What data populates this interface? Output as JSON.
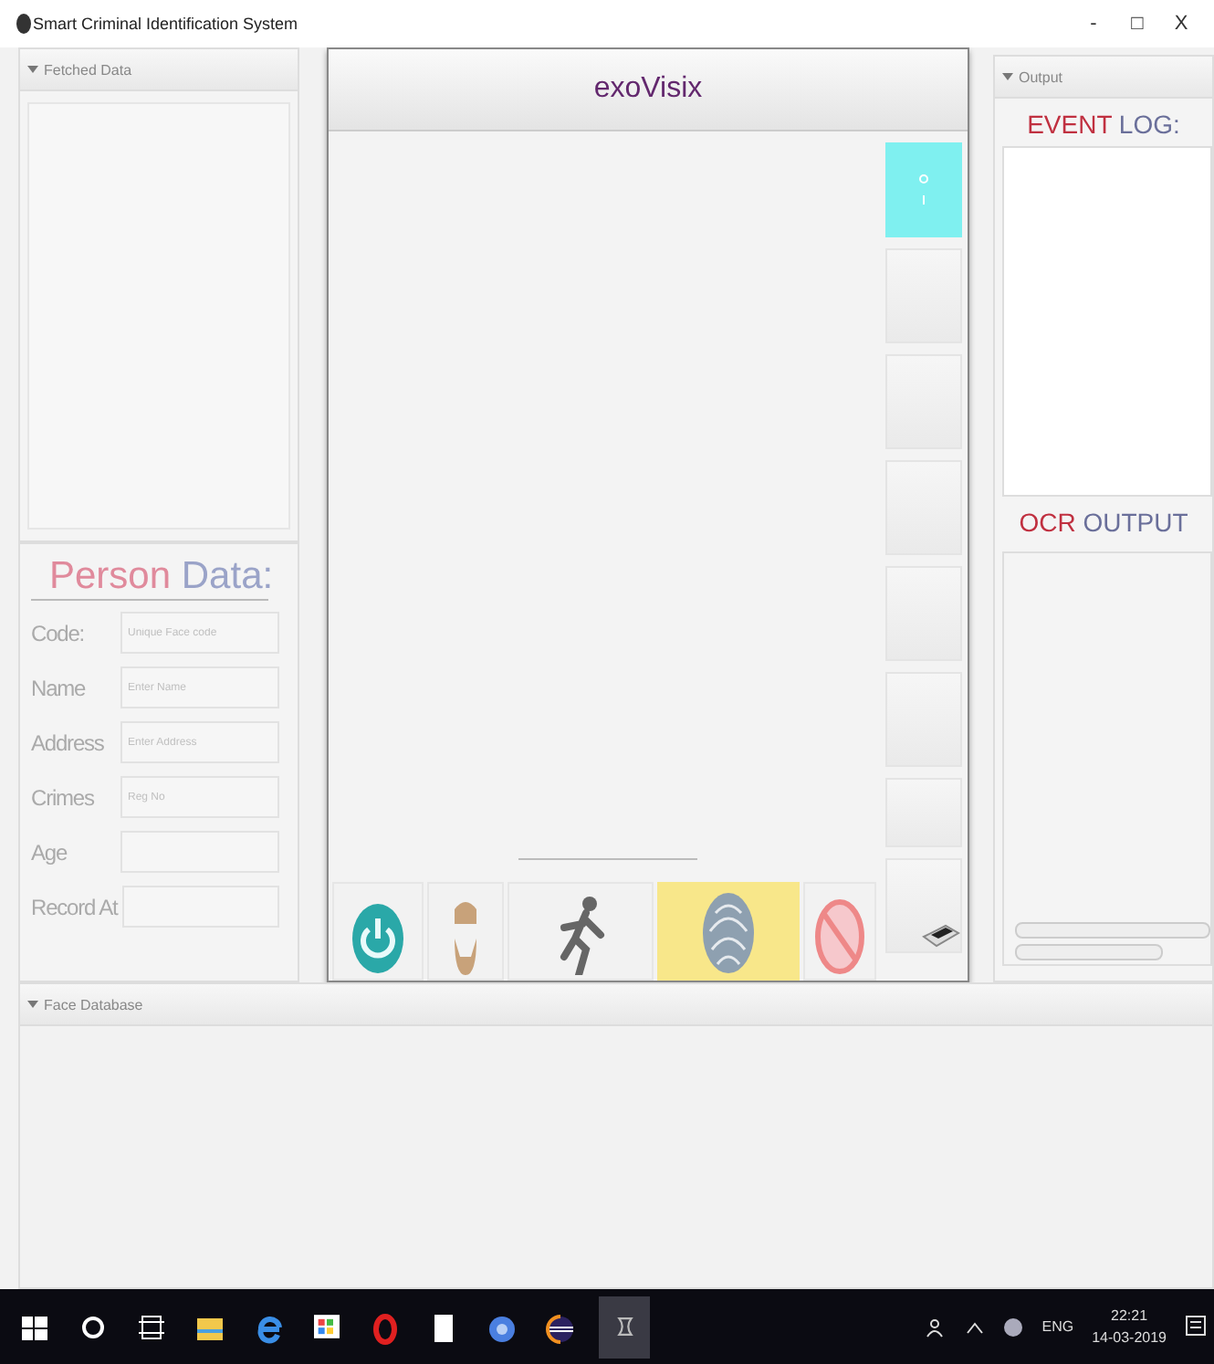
{
  "window": {
    "title": "Smart Criminal Identification System",
    "controls": [
      "-",
      "□",
      "X"
    ]
  },
  "fetched_data": {
    "header": "Fetched Data",
    "expanded": true
  },
  "person_data": {
    "heading": "Person Data:",
    "fields": [
      {
        "label": "Code:",
        "placeholder": "Unique Face code"
      },
      {
        "label": "Name",
        "placeholder": "Enter Name"
      },
      {
        "label": "Address",
        "placeholder": "Enter Address"
      },
      {
        "label": "Crimes",
        "placeholder": "Reg No"
      },
      {
        "label": "Age"
      },
      {
        "label": "Record At"
      }
    ]
  },
  "viewer": {
    "title": "exoVisix"
  },
  "side_buttons": [
    {
      "kind": "toggle",
      "on": true
    },
    {
      "kind": "blank",
      "on": false
    },
    {
      "kind": "blank",
      "on": false
    },
    {
      "kind": "blank",
      "on": false
    },
    {
      "kind": "blank",
      "on": false
    },
    {
      "kind": "blank",
      "on": false
    },
    {
      "kind": "blank",
      "on": false
    },
    {
      "kind": "printer",
      "on": false
    }
  ],
  "tools": [
    {
      "kind": "power",
      "selected": false
    },
    {
      "kind": "face",
      "selected": false
    },
    {
      "kind": "runner",
      "selected": false
    },
    {
      "kind": "fingerprint",
      "selected": true
    },
    {
      "kind": "forbidden",
      "selected": false
    }
  ],
  "output": {
    "header": "Output",
    "expanded": true,
    "event_log": "EVENT LOG:",
    "ocr_output": "OCR OUTPUT"
  },
  "face_database": {
    "header": "Face Database",
    "expanded": true
  },
  "taskbar": {
    "apps": [
      {
        "kind": "start"
      },
      {
        "kind": "search"
      },
      {
        "kind": "taskview"
      },
      {
        "kind": "folder"
      },
      {
        "kind": "edge"
      },
      {
        "kind": "store"
      },
      {
        "kind": "opera"
      },
      {
        "kind": "file"
      },
      {
        "kind": "chrome"
      },
      {
        "kind": "eclipse"
      },
      {
        "kind": "java",
        "active": true
      }
    ],
    "language": "ENG",
    "time": "22:21",
    "date": "14-03-2019"
  }
}
